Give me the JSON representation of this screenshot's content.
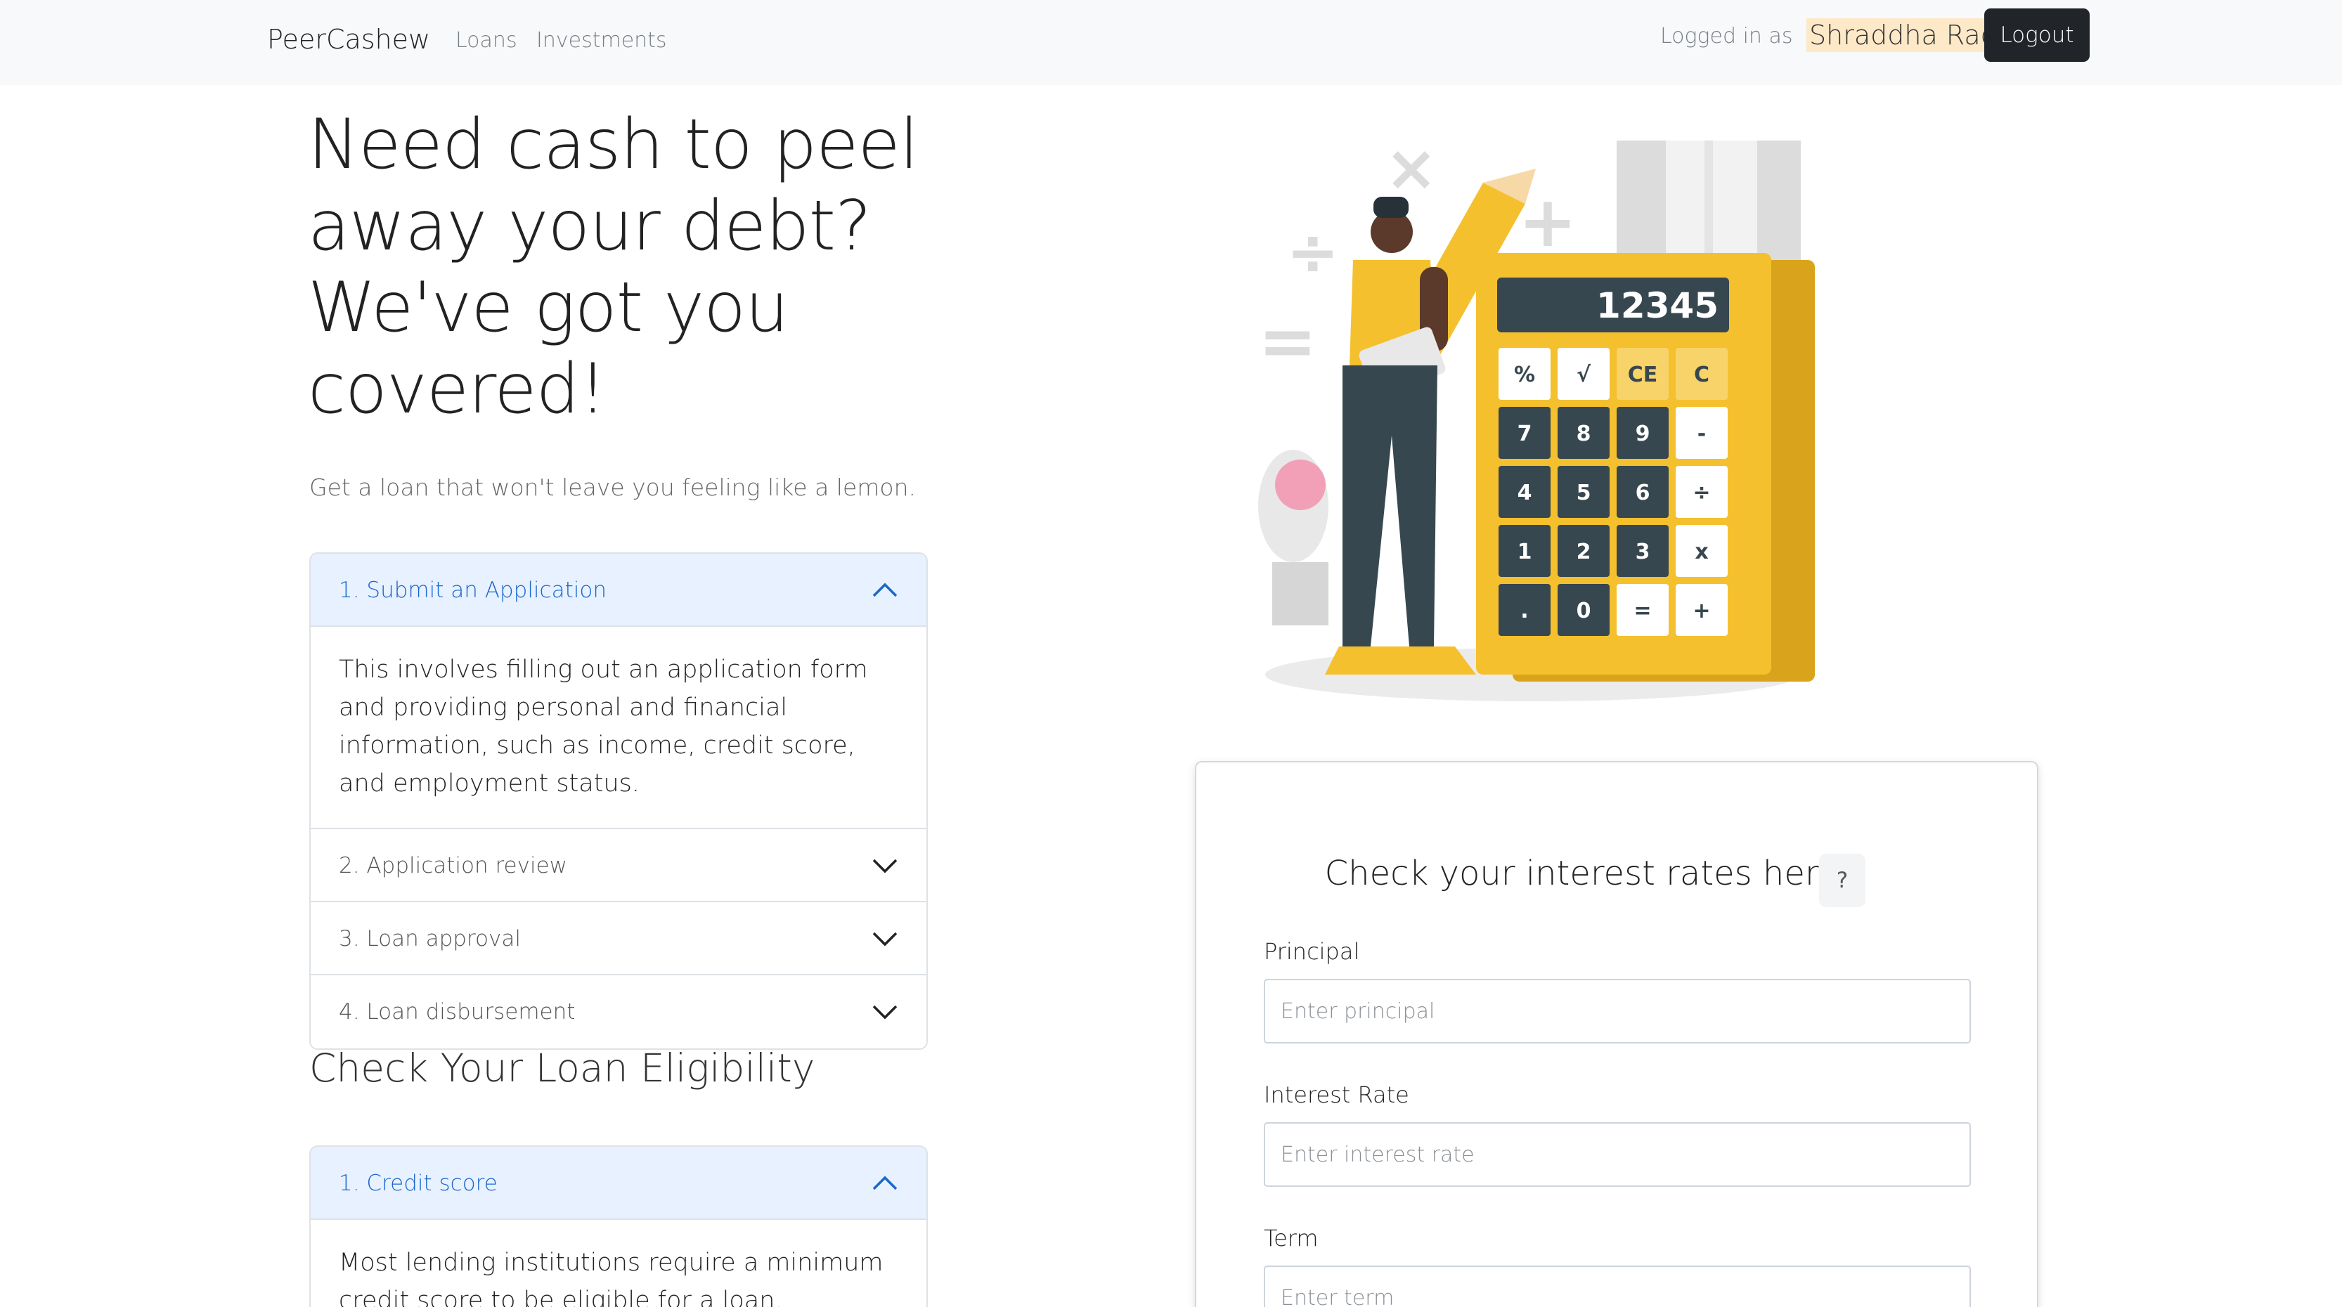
{
  "nav": {
    "brand": "PeerCashew",
    "links": [
      "Loans",
      "Investments"
    ],
    "logged_in_label": "Logged in as",
    "user_name": "Shraddha Rao",
    "logout_label": "Logout"
  },
  "hero": {
    "title": "Need cash to peel away your debt? We've got you covered!",
    "subtitle": "Get a loan that won't leave you feeling like a lemon."
  },
  "process_accordion": {
    "items": [
      {
        "label": "1. Submit an Application",
        "expanded": true,
        "body": "This involves filling out an application form and providing personal and financial information, such as income, credit score, and employment status."
      },
      {
        "label": "2. Application review",
        "expanded": false
      },
      {
        "label": "3. Loan approval",
        "expanded": false
      },
      {
        "label": "4. Loan disbursement",
        "expanded": false
      }
    ]
  },
  "eligibility": {
    "heading": "Check Your Loan Eligibility",
    "items": [
      {
        "label": "1. Credit score",
        "expanded": true,
        "body": "Most lending institutions require a minimum credit score to be eligible for a loan."
      }
    ]
  },
  "illustration": {
    "display_value": "12345",
    "keys": [
      "%",
      "√",
      "CE",
      "C",
      "7",
      "8",
      "9",
      "-",
      "4",
      "5",
      "6",
      "÷",
      "1",
      "2",
      "3",
      "x",
      ".",
      "0",
      "=",
      "+"
    ],
    "symbols": [
      "×",
      "+",
      "÷",
      "="
    ]
  },
  "rate_card": {
    "title": "Check your interest rates here!",
    "help": "?",
    "fields": [
      {
        "label": "Principal",
        "placeholder": "Enter principal"
      },
      {
        "label": "Interest Rate",
        "placeholder": "Enter interest rate"
      },
      {
        "label": "Term",
        "placeholder": "Enter term"
      }
    ]
  },
  "colors": {
    "accent_yellow": "#f4c02e",
    "calculator_dark": "#37474f",
    "navbar_bg": "#f8f9fa",
    "accordion_active_bg": "#e7f1ff",
    "accordion_active_text": "#1a66cc",
    "user_highlight": "#fde9c8"
  }
}
